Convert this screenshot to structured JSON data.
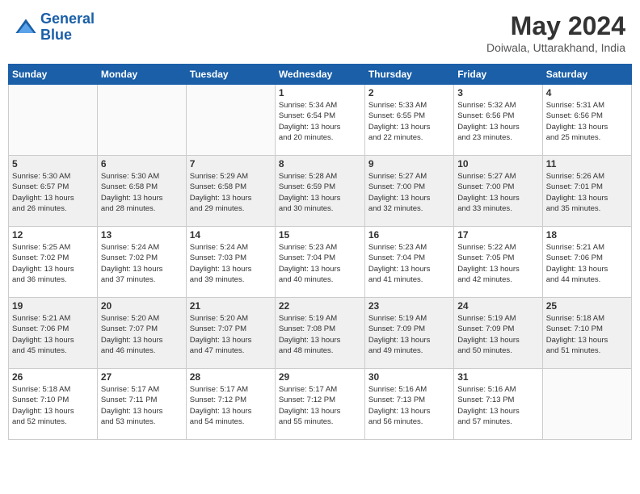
{
  "header": {
    "logo_line1": "General",
    "logo_line2": "Blue",
    "month_year": "May 2024",
    "location": "Doiwala, Uttarakhand, India"
  },
  "weekdays": [
    "Sunday",
    "Monday",
    "Tuesday",
    "Wednesday",
    "Thursday",
    "Friday",
    "Saturday"
  ],
  "weeks": [
    [
      {
        "day": "",
        "info": ""
      },
      {
        "day": "",
        "info": ""
      },
      {
        "day": "",
        "info": ""
      },
      {
        "day": "1",
        "info": "Sunrise: 5:34 AM\nSunset: 6:54 PM\nDaylight: 13 hours\nand 20 minutes."
      },
      {
        "day": "2",
        "info": "Sunrise: 5:33 AM\nSunset: 6:55 PM\nDaylight: 13 hours\nand 22 minutes."
      },
      {
        "day": "3",
        "info": "Sunrise: 5:32 AM\nSunset: 6:56 PM\nDaylight: 13 hours\nand 23 minutes."
      },
      {
        "day": "4",
        "info": "Sunrise: 5:31 AM\nSunset: 6:56 PM\nDaylight: 13 hours\nand 25 minutes."
      }
    ],
    [
      {
        "day": "5",
        "info": "Sunrise: 5:30 AM\nSunset: 6:57 PM\nDaylight: 13 hours\nand 26 minutes."
      },
      {
        "day": "6",
        "info": "Sunrise: 5:30 AM\nSunset: 6:58 PM\nDaylight: 13 hours\nand 28 minutes."
      },
      {
        "day": "7",
        "info": "Sunrise: 5:29 AM\nSunset: 6:58 PM\nDaylight: 13 hours\nand 29 minutes."
      },
      {
        "day": "8",
        "info": "Sunrise: 5:28 AM\nSunset: 6:59 PM\nDaylight: 13 hours\nand 30 minutes."
      },
      {
        "day": "9",
        "info": "Sunrise: 5:27 AM\nSunset: 7:00 PM\nDaylight: 13 hours\nand 32 minutes."
      },
      {
        "day": "10",
        "info": "Sunrise: 5:27 AM\nSunset: 7:00 PM\nDaylight: 13 hours\nand 33 minutes."
      },
      {
        "day": "11",
        "info": "Sunrise: 5:26 AM\nSunset: 7:01 PM\nDaylight: 13 hours\nand 35 minutes."
      }
    ],
    [
      {
        "day": "12",
        "info": "Sunrise: 5:25 AM\nSunset: 7:02 PM\nDaylight: 13 hours\nand 36 minutes."
      },
      {
        "day": "13",
        "info": "Sunrise: 5:24 AM\nSunset: 7:02 PM\nDaylight: 13 hours\nand 37 minutes."
      },
      {
        "day": "14",
        "info": "Sunrise: 5:24 AM\nSunset: 7:03 PM\nDaylight: 13 hours\nand 39 minutes."
      },
      {
        "day": "15",
        "info": "Sunrise: 5:23 AM\nSunset: 7:04 PM\nDaylight: 13 hours\nand 40 minutes."
      },
      {
        "day": "16",
        "info": "Sunrise: 5:23 AM\nSunset: 7:04 PM\nDaylight: 13 hours\nand 41 minutes."
      },
      {
        "day": "17",
        "info": "Sunrise: 5:22 AM\nSunset: 7:05 PM\nDaylight: 13 hours\nand 42 minutes."
      },
      {
        "day": "18",
        "info": "Sunrise: 5:21 AM\nSunset: 7:06 PM\nDaylight: 13 hours\nand 44 minutes."
      }
    ],
    [
      {
        "day": "19",
        "info": "Sunrise: 5:21 AM\nSunset: 7:06 PM\nDaylight: 13 hours\nand 45 minutes."
      },
      {
        "day": "20",
        "info": "Sunrise: 5:20 AM\nSunset: 7:07 PM\nDaylight: 13 hours\nand 46 minutes."
      },
      {
        "day": "21",
        "info": "Sunrise: 5:20 AM\nSunset: 7:07 PM\nDaylight: 13 hours\nand 47 minutes."
      },
      {
        "day": "22",
        "info": "Sunrise: 5:19 AM\nSunset: 7:08 PM\nDaylight: 13 hours\nand 48 minutes."
      },
      {
        "day": "23",
        "info": "Sunrise: 5:19 AM\nSunset: 7:09 PM\nDaylight: 13 hours\nand 49 minutes."
      },
      {
        "day": "24",
        "info": "Sunrise: 5:19 AM\nSunset: 7:09 PM\nDaylight: 13 hours\nand 50 minutes."
      },
      {
        "day": "25",
        "info": "Sunrise: 5:18 AM\nSunset: 7:10 PM\nDaylight: 13 hours\nand 51 minutes."
      }
    ],
    [
      {
        "day": "26",
        "info": "Sunrise: 5:18 AM\nSunset: 7:10 PM\nDaylight: 13 hours\nand 52 minutes."
      },
      {
        "day": "27",
        "info": "Sunrise: 5:17 AM\nSunset: 7:11 PM\nDaylight: 13 hours\nand 53 minutes."
      },
      {
        "day": "28",
        "info": "Sunrise: 5:17 AM\nSunset: 7:12 PM\nDaylight: 13 hours\nand 54 minutes."
      },
      {
        "day": "29",
        "info": "Sunrise: 5:17 AM\nSunset: 7:12 PM\nDaylight: 13 hours\nand 55 minutes."
      },
      {
        "day": "30",
        "info": "Sunrise: 5:16 AM\nSunset: 7:13 PM\nDaylight: 13 hours\nand 56 minutes."
      },
      {
        "day": "31",
        "info": "Sunrise: 5:16 AM\nSunset: 7:13 PM\nDaylight: 13 hours\nand 57 minutes."
      },
      {
        "day": "",
        "info": ""
      }
    ]
  ]
}
